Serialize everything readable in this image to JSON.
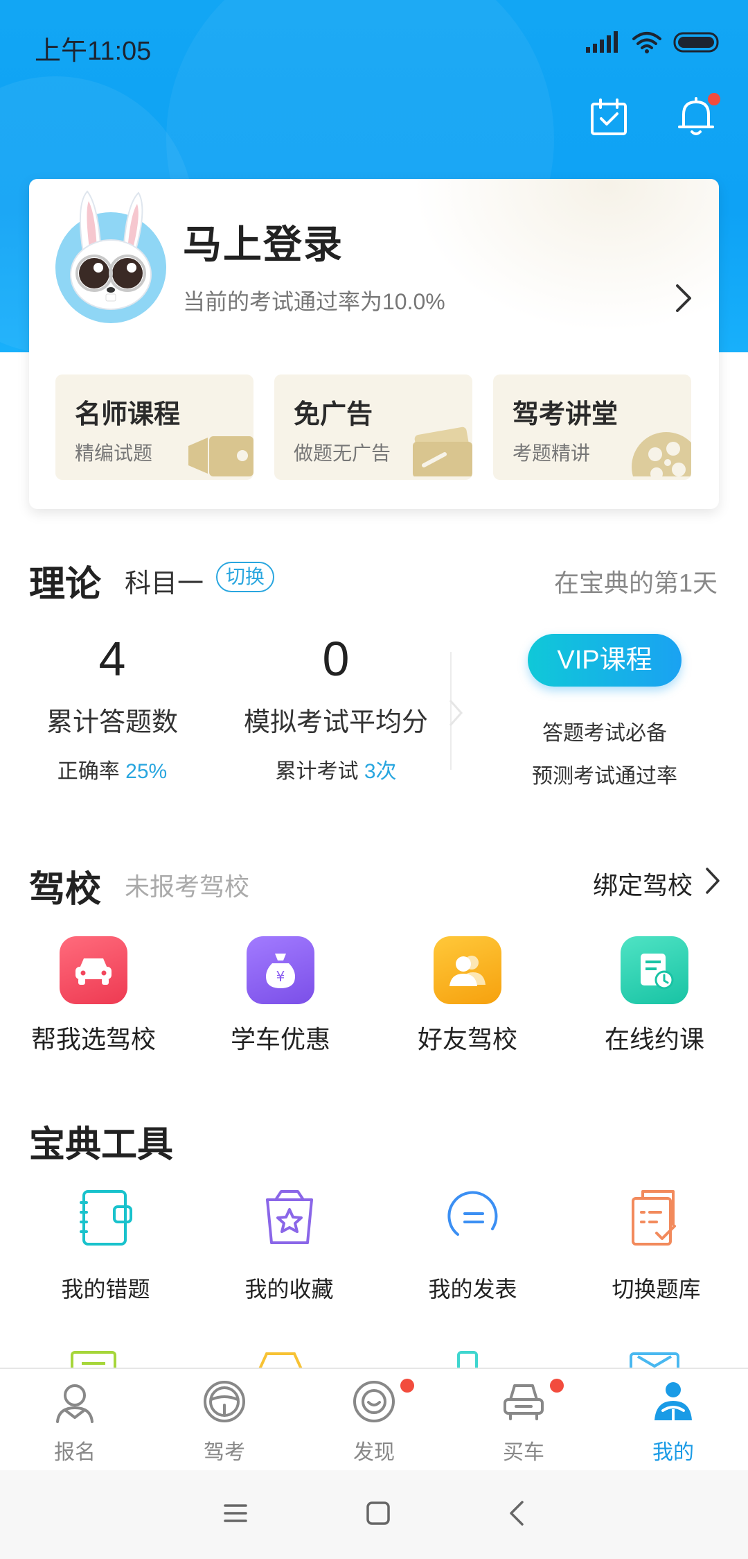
{
  "status": {
    "time": "上午11:05"
  },
  "profile": {
    "title": "马上登录",
    "subtitle": "当前的考试通过率为10.0%",
    "features": [
      {
        "title": "名师课程",
        "sub": "精编试题"
      },
      {
        "title": "免广告",
        "sub": "做题无广告"
      },
      {
        "title": "驾考讲堂",
        "sub": "考题精讲"
      }
    ]
  },
  "theory": {
    "title": "理论",
    "subject": "科目一",
    "switch_label": "切换",
    "days": "在宝典的第1天",
    "answered": {
      "value": "4",
      "label": "累计答题数",
      "meta_prefix": "正确率",
      "meta_value": "25%"
    },
    "exam": {
      "value": "0",
      "label": "模拟考试平均分",
      "meta_prefix": "累计考试",
      "meta_value": "3次"
    },
    "vip": {
      "button": "VIP课程",
      "line1": "答题考试必备",
      "line2": "预测考试通过率"
    }
  },
  "school": {
    "title": "驾校",
    "subtitle": "未报考驾校",
    "bind_label": "绑定驾校",
    "items": [
      {
        "label": "帮我选驾校",
        "icon": "car-icon",
        "color": "#f2465c"
      },
      {
        "label": "学车优惠",
        "icon": "money-bag-icon",
        "color": "#8a5cf0"
      },
      {
        "label": "好友驾校",
        "icon": "friends-icon",
        "color": "#f8b21c"
      },
      {
        "label": "在线约课",
        "icon": "schedule-icon",
        "color": "#1fcfae"
      }
    ]
  },
  "tools": {
    "title": "宝典工具",
    "items": [
      {
        "label": "我的错题",
        "icon": "notebook-icon"
      },
      {
        "label": "我的收藏",
        "icon": "star-bag-icon"
      },
      {
        "label": "我的发表",
        "icon": "comment-icon"
      },
      {
        "label": "切换题库",
        "icon": "question-bank-icon"
      }
    ]
  },
  "tabs": [
    {
      "label": "报名",
      "icon": "signup-icon",
      "dot": false
    },
    {
      "label": "驾考",
      "icon": "steering-wheel-icon",
      "dot": false
    },
    {
      "label": "发现",
      "icon": "discover-icon",
      "dot": true
    },
    {
      "label": "买车",
      "icon": "buy-car-icon",
      "dot": true
    },
    {
      "label": "我的",
      "icon": "profile-icon",
      "dot": false,
      "active": true
    }
  ],
  "colors": {
    "accent": "#1a9be6",
    "hero": "#12a6f4",
    "badge_red": "#f24c3d"
  }
}
